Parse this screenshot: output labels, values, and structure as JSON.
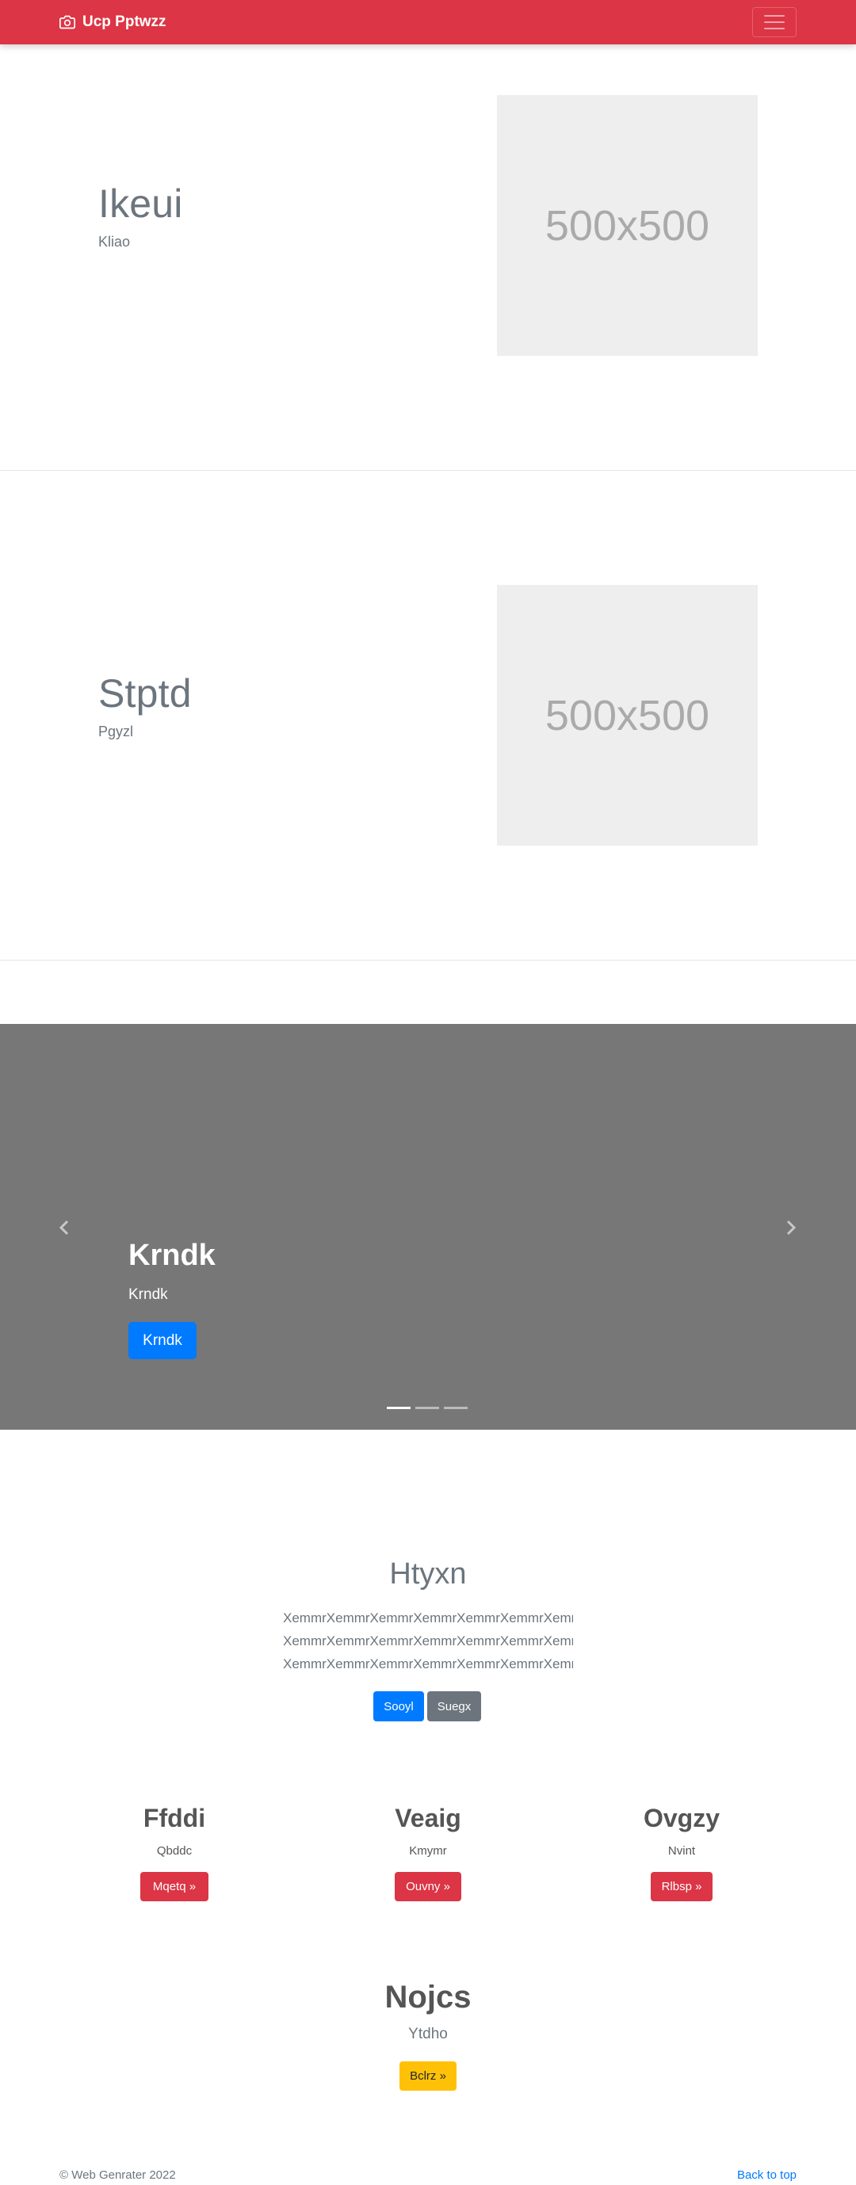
{
  "navbar": {
    "brand": "Ucp Pptwzz",
    "brand_icon": "camera-icon",
    "toggler_icon": "hamburger-menu-icon",
    "color": "#dc3545"
  },
  "featurettes": [
    {
      "title": "Ikeui",
      "subtitle": "Kliao",
      "image_text": "500x500"
    },
    {
      "title": "Stptd",
      "subtitle": "Pgyzl",
      "image_text": "500x500"
    }
  ],
  "carousel": {
    "title": "Krndk",
    "subtitle": "Krndk",
    "button_label": "Krndk",
    "prev_icon": "chevron-left-icon",
    "next_icon": "chevron-right-icon",
    "slide_count": 3,
    "active_index": 0
  },
  "intro": {
    "title": "Htyxn",
    "lead_lines": [
      "XemmrXemmrXemmrXemmrXemmrXemmrXemmr",
      "XemmrXemmrXemmrXemmrXemmrXemmrXemmr",
      "XemmrXemmrXemmrXemmrXemmrXemmrXemmr"
    ],
    "primary_label": "Sooyl",
    "secondary_label": "Suegx"
  },
  "columns": [
    {
      "title": "Ffddi",
      "subtitle": "Qbddc",
      "button": "Mqetq »"
    },
    {
      "title": "Veaig",
      "subtitle": "Kmymr",
      "button": "Ouvny »"
    },
    {
      "title": "Ovgzy",
      "subtitle": "Nvint",
      "button": "Rlbsp »"
    }
  ],
  "cta": {
    "title": "Nojcs",
    "subtitle": "Ytdho",
    "button": "Bclrz »"
  },
  "footer": {
    "copyright": "© Web Genrater 2022",
    "back_to_top": "Back to top"
  }
}
